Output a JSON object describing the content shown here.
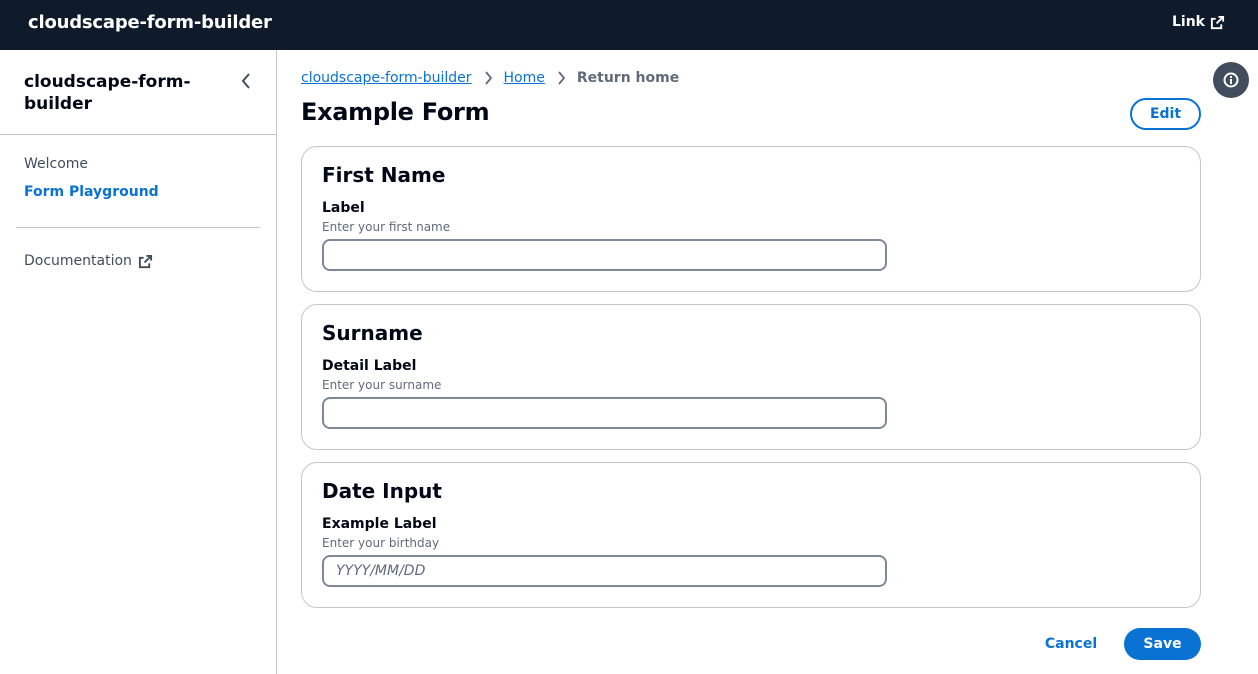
{
  "topnav": {
    "title": "cloudscape-form-builder",
    "link_label": "Link",
    "link_icon": "external-link-icon"
  },
  "sidebar": {
    "header": "cloudscape-form-builder",
    "collapse_icon": "chevron-left-icon",
    "items": [
      {
        "label": "Welcome",
        "active": false
      },
      {
        "label": "Form Playground",
        "active": true
      }
    ],
    "footer_items": [
      {
        "label": "Documentation",
        "icon": "external-link-icon"
      }
    ]
  },
  "breadcrumbs": [
    {
      "label": "cloudscape-form-builder",
      "link": true
    },
    {
      "label": "Home",
      "link": true
    },
    {
      "label": "Return home",
      "link": false
    }
  ],
  "page": {
    "title": "Example Form",
    "edit_label": "Edit",
    "info_icon": "info-icon"
  },
  "sections": [
    {
      "title": "First Name",
      "label": "Label",
      "description": "Enter your first name",
      "value": "",
      "placeholder": ""
    },
    {
      "title": "Surname",
      "label": "Detail Label",
      "description": "Enter your surname",
      "value": "",
      "placeholder": ""
    },
    {
      "title": "Date Input",
      "label": "Example Label",
      "description": "Enter your birthday",
      "value": "",
      "placeholder": "YYYY/MM/DD"
    }
  ],
  "actions": {
    "cancel_label": "Cancel",
    "save_label": "Save"
  },
  "colors": {
    "header_bg": "#0f1b2a",
    "accent": "#0972d3",
    "text": "#000716",
    "muted": "#5f6b7a",
    "border": "#c6c6cd"
  }
}
